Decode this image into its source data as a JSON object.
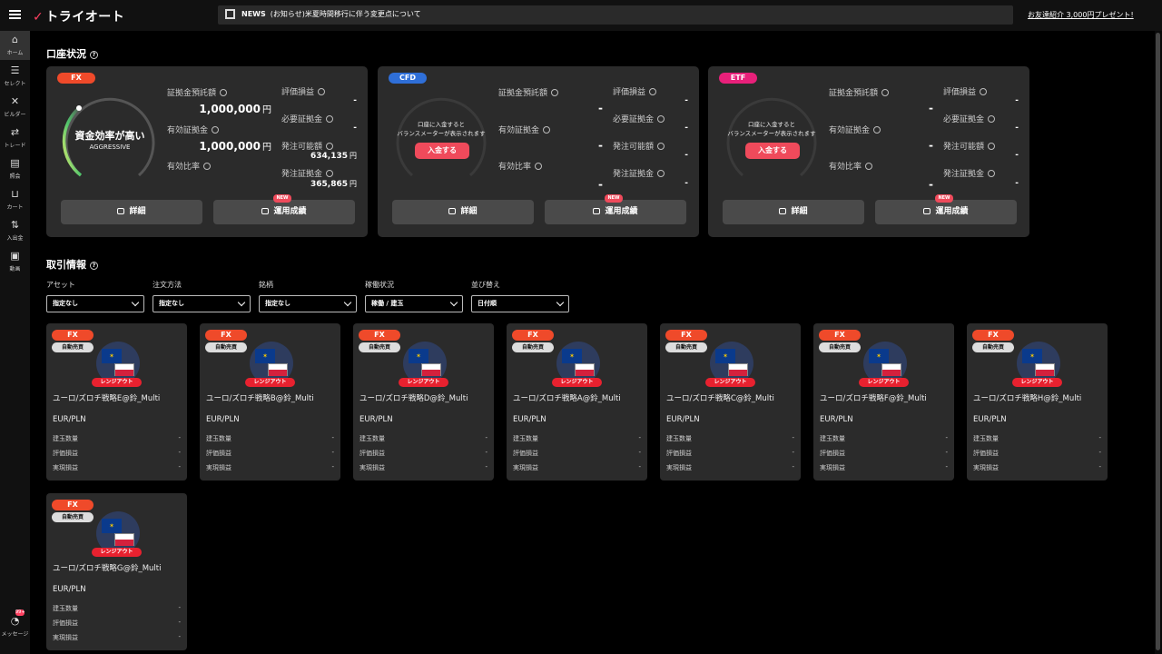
{
  "header": {
    "logo_mark": "✓",
    "logo_text": "トライオート",
    "news_label": "NEWS",
    "news_text": "(お知らせ)米夏時間移行に伴う変更点について",
    "invite": "お友達紹介 3,000円プレゼント!"
  },
  "sidebar": {
    "items": [
      {
        "label": "ホーム",
        "icon": "home-icon",
        "glyph": "⌂"
      },
      {
        "label": "セレクト",
        "icon": "select-icon",
        "glyph": "☰"
      },
      {
        "label": "ビルダー",
        "icon": "builder-icon",
        "glyph": "✕"
      },
      {
        "label": "トレード",
        "icon": "trade-icon",
        "glyph": "⇄"
      },
      {
        "label": "照会",
        "icon": "inquiry-icon",
        "glyph": "▤"
      },
      {
        "label": "カート",
        "icon": "cart-icon",
        "glyph": "⊔"
      },
      {
        "label": "入出金",
        "icon": "deposit-icon",
        "glyph": "⇅"
      },
      {
        "label": "動画",
        "icon": "video-icon",
        "glyph": "▣"
      }
    ],
    "message": {
      "label": "メッセージ",
      "badge": "99+",
      "glyph": "◔"
    }
  },
  "account_section": {
    "title": "口座状況",
    "accounts": [
      {
        "tag": "FX",
        "tag_color": "#ef4a2a",
        "gauge_main": "資金効率が高い",
        "gauge_sub": "AGGRESSIVE",
        "margin_deposit_label": "証拠金預託額",
        "margin_deposit": "1,000,000",
        "unit": "円",
        "effective_margin_label": "有効証拠金",
        "effective_margin": "1,000,000",
        "effective_ratio_label": "有効比率",
        "effective_ratio": "",
        "pl_label": "評価損益",
        "pl": "-",
        "required_label": "必要証拠金",
        "required": "-",
        "orderable_label": "発注可能額",
        "orderable": "634,135",
        "order_margin_label": "発注証拠金",
        "order_margin": "365,865",
        "detail_btn": "詳細",
        "perf_btn": "運用成績",
        "new_badge": "NEW"
      },
      {
        "tag": "CFD",
        "tag_color": "#2f6fd8",
        "gauge_placeholder": "口座に入金すると\nバランスメーターが表示されます",
        "deposit_btn": "入金する",
        "margin_deposit_label": "証拠金預託額",
        "margin_deposit": "-",
        "effective_margin_label": "有効証拠金",
        "effective_margin": "-",
        "effective_ratio_label": "有効比率",
        "effective_ratio": "-",
        "pl_label": "評価損益",
        "pl": "-",
        "required_label": "必要証拠金",
        "required": "-",
        "orderable_label": "発注可能額",
        "orderable": "-",
        "order_margin_label": "発注証拠金",
        "order_margin": "-",
        "detail_btn": "詳細",
        "perf_btn": "運用成績",
        "new_badge": "NEW"
      },
      {
        "tag": "ETF",
        "tag_color": "#e8207a",
        "gauge_placeholder": "口座に入金すると\nバランスメーターが表示されます",
        "deposit_btn": "入金する",
        "margin_deposit_label": "証拠金預託額",
        "margin_deposit": "-",
        "effective_margin_label": "有効証拠金",
        "effective_margin": "-",
        "effective_ratio_label": "有効比率",
        "effective_ratio": "-",
        "pl_label": "評価損益",
        "pl": "-",
        "required_label": "必要証拠金",
        "required": "-",
        "orderable_label": "発注可能額",
        "orderable": "-",
        "order_margin_label": "発注証拠金",
        "order_margin": "-",
        "detail_btn": "詳細",
        "perf_btn": "運用成績",
        "new_badge": "NEW"
      }
    ]
  },
  "trade_section": {
    "title": "取引情報",
    "filters": [
      {
        "label": "アセット",
        "value": "指定なし"
      },
      {
        "label": "注文方法",
        "value": "指定なし"
      },
      {
        "label": "銘柄",
        "value": "指定なし"
      },
      {
        "label": "稼働状況",
        "value": "稼働 / 建玉"
      },
      {
        "label": "並び替え",
        "value": "日付順"
      }
    ],
    "cards": [
      {
        "tag": "FX",
        "type": "自動売買",
        "status": "レンジアウト",
        "name": "ユーロ/ズロチ戦略E@鈴_Multi",
        "pair": "EUR/PLN",
        "rows": [
          {
            "label": "建玉数量",
            "value": "-"
          },
          {
            "label": "評価損益",
            "value": "-"
          },
          {
            "label": "実現損益",
            "value": "-"
          }
        ]
      },
      {
        "tag": "FX",
        "type": "自動売買",
        "status": "レンジアウト",
        "name": "ユーロ/ズロチ戦略B@鈴_Multi",
        "pair": "EUR/PLN",
        "rows": [
          {
            "label": "建玉数量",
            "value": "-"
          },
          {
            "label": "評価損益",
            "value": "-"
          },
          {
            "label": "実現損益",
            "value": "-"
          }
        ]
      },
      {
        "tag": "FX",
        "type": "自動売買",
        "status": "レンジアウト",
        "name": "ユーロ/ズロチ戦略D@鈴_Multi",
        "pair": "EUR/PLN",
        "rows": [
          {
            "label": "建玉数量",
            "value": "-"
          },
          {
            "label": "評価損益",
            "value": "-"
          },
          {
            "label": "実現損益",
            "value": "-"
          }
        ]
      },
      {
        "tag": "FX",
        "type": "自動売買",
        "status": "レンジアウト",
        "name": "ユーロ/ズロチ戦略A@鈴_Multi",
        "pair": "EUR/PLN",
        "rows": [
          {
            "label": "建玉数量",
            "value": "-"
          },
          {
            "label": "評価損益",
            "value": "-"
          },
          {
            "label": "実現損益",
            "value": "-"
          }
        ]
      },
      {
        "tag": "FX",
        "type": "自動売買",
        "status": "レンジアウト",
        "name": "ユーロ/ズロチ戦略C@鈴_Multi",
        "pair": "EUR/PLN",
        "rows": [
          {
            "label": "建玉数量",
            "value": "-"
          },
          {
            "label": "評価損益",
            "value": "-"
          },
          {
            "label": "実現損益",
            "value": "-"
          }
        ]
      },
      {
        "tag": "FX",
        "type": "自動売買",
        "status": "レンジアウト",
        "name": "ユーロ/ズロチ戦略F@鈴_Multi",
        "pair": "EUR/PLN",
        "rows": [
          {
            "label": "建玉数量",
            "value": "-"
          },
          {
            "label": "評価損益",
            "value": "-"
          },
          {
            "label": "実現損益",
            "value": "-"
          }
        ]
      },
      {
        "tag": "FX",
        "type": "自動売買",
        "status": "レンジアウト",
        "name": "ユーロ/ズロチ戦略H@鈴_Multi",
        "pair": "EUR/PLN",
        "rows": [
          {
            "label": "建玉数量",
            "value": "-"
          },
          {
            "label": "評価損益",
            "value": "-"
          },
          {
            "label": "実現損益",
            "value": "-"
          }
        ]
      },
      {
        "tag": "FX",
        "type": "自動売買",
        "status": "レンジアウト",
        "name": "ユーロ/ズロチ戦略G@鈴_Multi",
        "pair": "EUR/PLN",
        "rows": [
          {
            "label": "建玉数量",
            "value": "-"
          },
          {
            "label": "評価損益",
            "value": "-"
          },
          {
            "label": "実現損益",
            "value": "-"
          }
        ]
      }
    ]
  }
}
